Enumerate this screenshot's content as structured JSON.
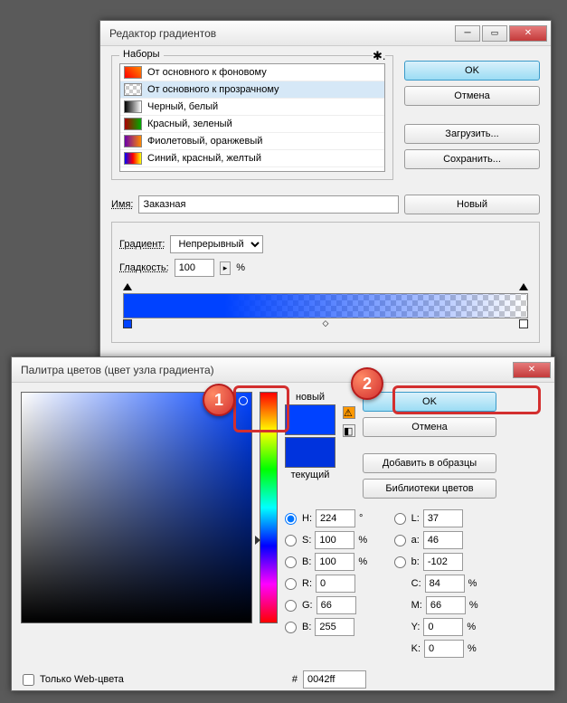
{
  "gradient_editor": {
    "title": "Редактор градиентов",
    "presets_label": "Наборы",
    "presets": [
      {
        "label": "От основного к фоновому",
        "grad": "linear-gradient(45deg,#ff0000,#ff8800)"
      },
      {
        "label": "От основного к прозрачному",
        "grad": "repeating-conic-gradient(#ccc 0 25%,#fff 0 50%) 50%/8px 8px"
      },
      {
        "label": "Черный, белый",
        "grad": "linear-gradient(to right,#000,#fff)"
      },
      {
        "label": "Красный, зеленый",
        "grad": "linear-gradient(to right,#aa0000,#00aa00)"
      },
      {
        "label": "Фиолетовый, оранжевый",
        "grad": "linear-gradient(to right,#6a00aa,#ff8800)"
      },
      {
        "label": "Синий, красный, желтый",
        "grad": "linear-gradient(to right,#0000ff,#ff0000,#ffff00)"
      }
    ],
    "ok": "OK",
    "cancel": "Отмена",
    "load": "Загрузить...",
    "save": "Сохранить...",
    "name_label": "Имя:",
    "name_value": "Заказная",
    "new_btn": "Новый",
    "gradient_type_label": "Градиент:",
    "gradient_type_value": "Непрерывный",
    "smoothness_label": "Гладкость:",
    "smoothness_value": "100",
    "smoothness_unit": "%"
  },
  "color_picker": {
    "title": "Палитра цветов (цвет узла градиента)",
    "ok": "OK",
    "cancel": "Отмена",
    "add_swatch": "Добавить в образцы",
    "libraries": "Библиотеки цветов",
    "new_label": "новый",
    "current_label": "текущий",
    "web_only": "Только Web-цвета",
    "hex_label": "#",
    "hex_value": "0042ff",
    "H": {
      "label": "H:",
      "value": "224",
      "unit": "°"
    },
    "S": {
      "label": "S:",
      "value": "100",
      "unit": "%"
    },
    "Bv": {
      "label": "B:",
      "value": "100",
      "unit": "%"
    },
    "R": {
      "label": "R:",
      "value": "0"
    },
    "G": {
      "label": "G:",
      "value": "66"
    },
    "Bc": {
      "label": "B:",
      "value": "255"
    },
    "L": {
      "label": "L:",
      "value": "37"
    },
    "a": {
      "label": "a:",
      "value": "46"
    },
    "b": {
      "label": "b:",
      "value": "-102"
    },
    "C": {
      "label": "C:",
      "value": "84",
      "unit": "%"
    },
    "M": {
      "label": "M:",
      "value": "66",
      "unit": "%"
    },
    "Y": {
      "label": "Y:",
      "value": "0",
      "unit": "%"
    },
    "K": {
      "label": "K:",
      "value": "0",
      "unit": "%"
    }
  },
  "callouts": {
    "one": "1",
    "two": "2"
  }
}
